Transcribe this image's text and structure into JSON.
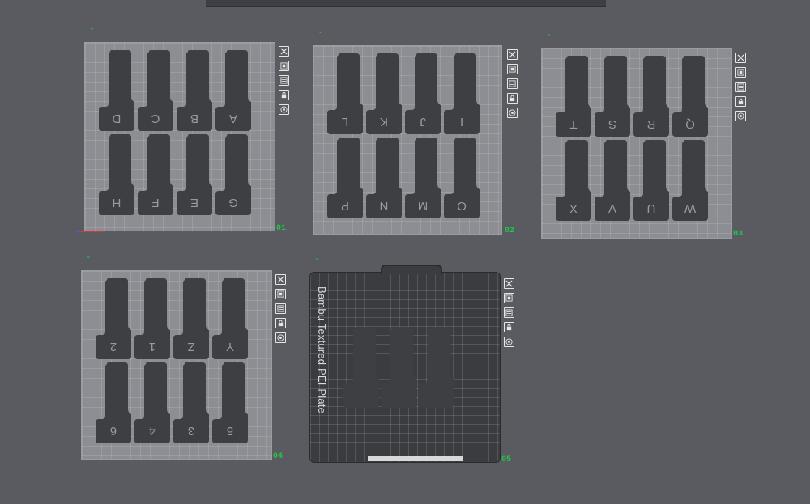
{
  "app": {
    "toolbar_label": ""
  },
  "plates": [
    {
      "index": "01",
      "tick": "⌄",
      "labels": [
        "D",
        "C",
        "B",
        "A",
        "H",
        "F",
        "E",
        "G"
      ]
    },
    {
      "index": "02",
      "tick": "⌄",
      "labels": [
        "L",
        "K",
        "J",
        "I",
        "P",
        "N",
        "M",
        "O"
      ]
    },
    {
      "index": "03",
      "tick": "⌄",
      "labels": [
        "T",
        "S",
        "R",
        "Q",
        "X",
        "V",
        "U",
        "W"
      ]
    },
    {
      "index": "04",
      "tick": "⌄",
      "labels": [
        "2",
        "1",
        "Z",
        "Y",
        "6",
        "4",
        "3",
        "5"
      ]
    },
    {
      "index": "05",
      "tick": "⌄",
      "labels": [],
      "plate_type": "Bambu Textured PEI Plate"
    }
  ],
  "plate_tools": [
    "close-icon",
    "arrange-icon",
    "settings-icon",
    "lock-icon",
    "orient-icon"
  ],
  "colors": {
    "background": "#5a5b60",
    "plate": "#8c8e93",
    "part": "#3e3f43",
    "label_green": "#1fc74a"
  }
}
